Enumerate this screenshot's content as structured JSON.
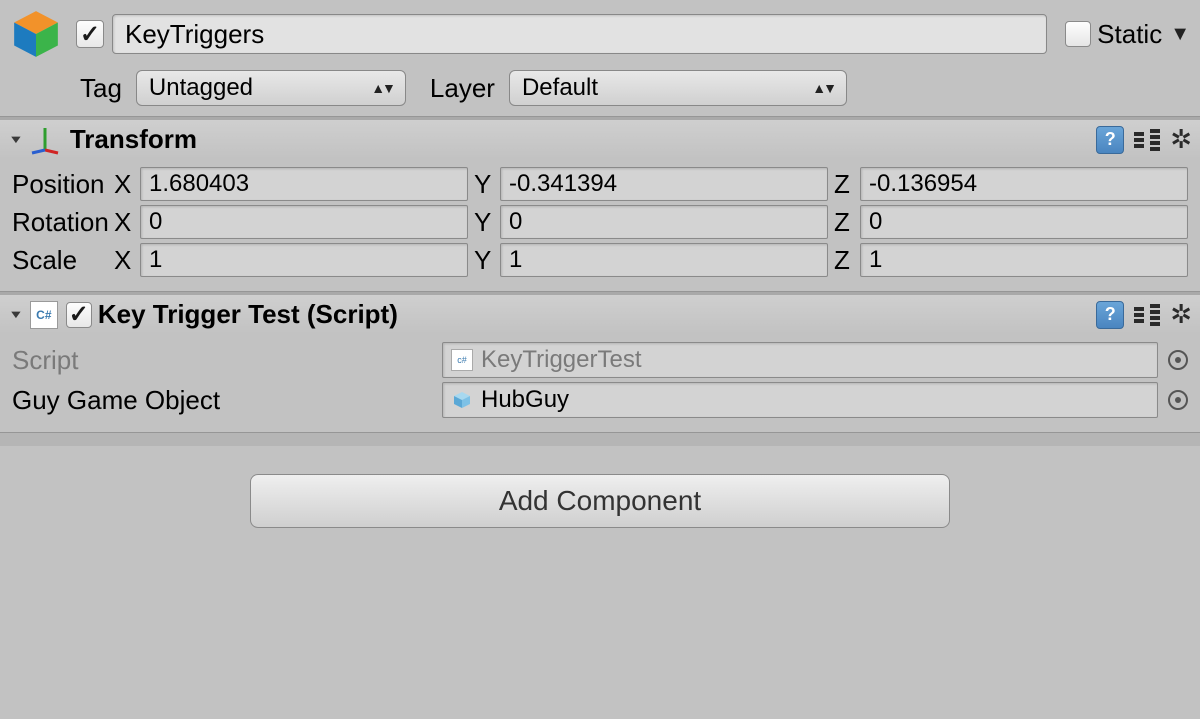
{
  "header": {
    "object_name": "KeyTriggers",
    "active_checked": true,
    "static_label": "Static",
    "static_checked": false,
    "tag_label": "Tag",
    "tag_value": "Untagged",
    "layer_label": "Layer",
    "layer_value": "Default"
  },
  "transform": {
    "title": "Transform",
    "position": {
      "label": "Position",
      "x": "1.680403",
      "y": "-0.341394",
      "z": "-0.136954"
    },
    "rotation": {
      "label": "Rotation",
      "x": "0",
      "y": "0",
      "z": "0"
    },
    "scale": {
      "label": "Scale",
      "x": "1",
      "y": "1",
      "z": "1"
    },
    "axis_labels": {
      "x": "X",
      "y": "Y",
      "z": "Z"
    }
  },
  "script_component": {
    "title": "Key Trigger Test (Script)",
    "enabled": true,
    "script_label": "Script",
    "script_value": "KeyTriggerTest",
    "guy_label": "Guy Game Object",
    "guy_value": "HubGuy"
  },
  "footer": {
    "add_component_label": "Add Component"
  }
}
